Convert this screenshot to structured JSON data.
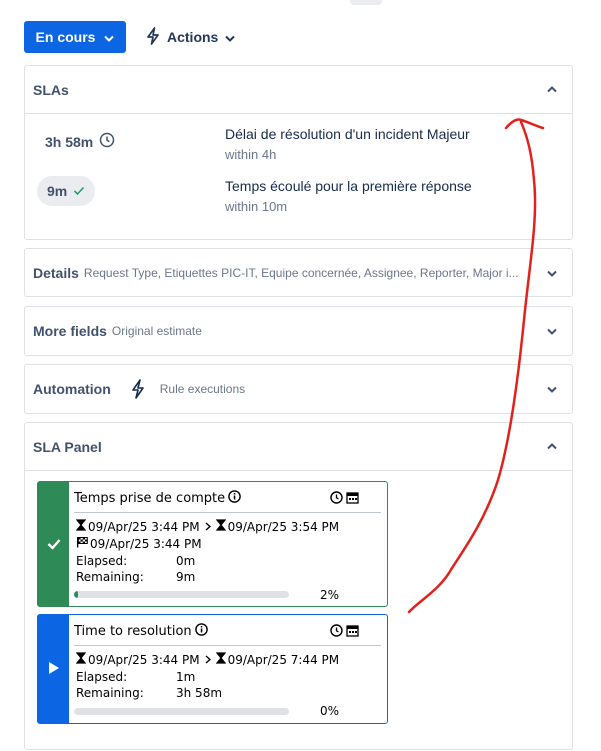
{
  "toolbar": {
    "status_label": "En cours",
    "actions_label": "Actions"
  },
  "slas": {
    "title": "SLAs",
    "items": [
      {
        "remaining": "3h 58m",
        "name": "Délai de résolution d'un incident Majeur",
        "goal": "within 4h",
        "state_icon": "clock-icon"
      },
      {
        "remaining": "9m",
        "name": "Temps écoulé pour la première réponse",
        "goal": "within 10m",
        "state_icon": "check-icon"
      }
    ]
  },
  "details": {
    "title": "Details",
    "summary": "Request Type, Etiquettes PIC-IT, Equipe concernée, Assignee, Reporter, Major i..."
  },
  "more_fields": {
    "title": "More fields",
    "summary": "Original estimate"
  },
  "automation": {
    "title": "Automation",
    "summary": "Rule executions"
  },
  "sla_panel": {
    "title": "SLA Panel",
    "cards": [
      {
        "title": "Temps prise de compte",
        "start": "09/Apr/25 3:44 PM",
        "target": "09/Apr/25 3:54 PM",
        "finished": "09/Apr/25 3:44 PM",
        "elapsed_label": "Elapsed:",
        "elapsed": "0m",
        "remaining_label": "Remaining:",
        "remaining": "9m",
        "progress_pct": 2,
        "progress_text": "2%",
        "state": "completed",
        "color": "#2e8b57"
      },
      {
        "title": "Time to resolution",
        "start": "09/Apr/25 3:44 PM",
        "target": "09/Apr/25 7:44 PM",
        "elapsed_label": "Elapsed:",
        "elapsed": "1m",
        "remaining_label": "Remaining:",
        "remaining": "3h 58m",
        "progress_pct": 0,
        "progress_text": "0%",
        "state": "running",
        "color": "#0c66e4"
      }
    ]
  },
  "colors": {
    "primary": "#0c66e4",
    "success": "#2e8b57",
    "annotation": "#e0221c"
  }
}
